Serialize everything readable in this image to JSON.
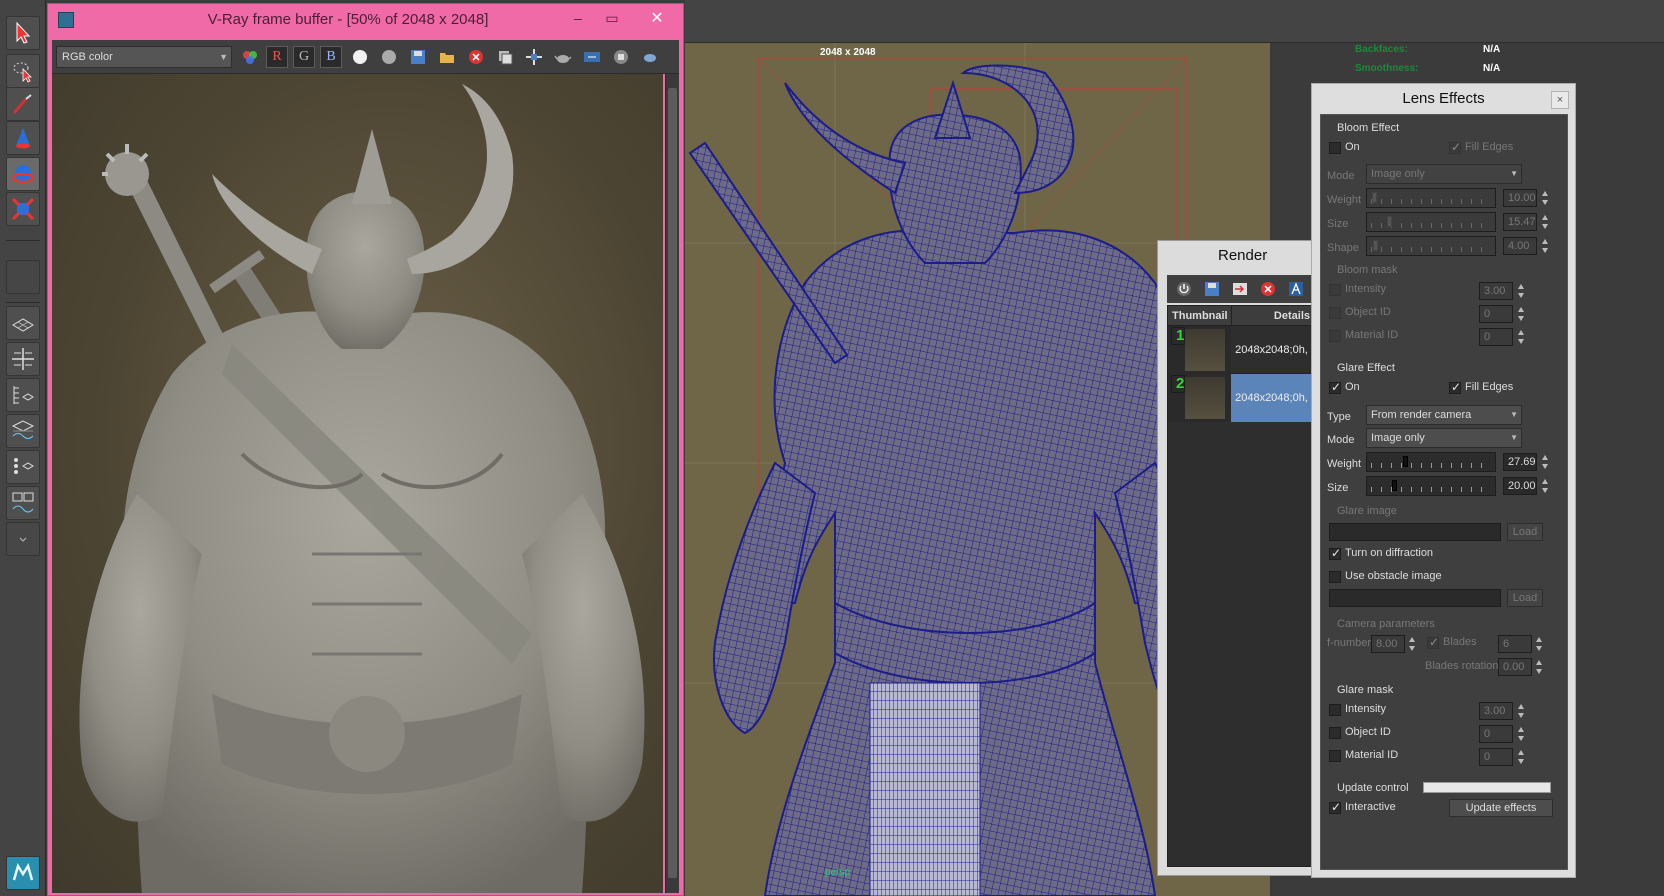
{
  "vfb": {
    "title": "V-Ray frame buffer - [50% of 2048 x 2048]",
    "channel": "RGB color",
    "channel_buttons": [
      "R",
      "G",
      "B"
    ]
  },
  "viewport": {
    "resolution_label": "2048 x 2048",
    "camera_label": "persp",
    "hud": [
      {
        "label": "Backfaces:",
        "value": "N/A"
      },
      {
        "label": "Smoothness:",
        "value": "N/A"
      }
    ],
    "hud_extra": [
      "efault",
      "057"
    ]
  },
  "render_history": {
    "title": "Render history",
    "columns": [
      "Thumbnail",
      "Details"
    ],
    "rows": [
      {
        "number": "1",
        "details": "2048x2048;0h,"
      },
      {
        "number": "2",
        "details": "2048x2048;0h,"
      }
    ]
  },
  "lens": {
    "title": "Lens Effects",
    "close": "×",
    "bloom": {
      "header": "Bloom Effect",
      "on_label": "On",
      "fill_edges_label": "Fill Edges",
      "mode_label": "Mode",
      "mode_value": "Image only",
      "weight_label": "Weight",
      "weight_value": "10.00",
      "size_label": "Size",
      "size_value": "15.47",
      "shape_label": "Shape",
      "shape_value": "4.00",
      "mask_header": "Bloom mask",
      "intensity_label": "Intensity",
      "intensity_value": "3.00",
      "object_id_label": "Object ID",
      "object_id_value": "0",
      "material_id_label": "Material ID",
      "material_id_value": "0"
    },
    "glare": {
      "header": "Glare Effect",
      "on_label": "On",
      "fill_edges_label": "Fill Edges",
      "type_label": "Type",
      "type_value": "From render camera",
      "mode_label": "Mode",
      "mode_value": "Image only",
      "weight_label": "Weight",
      "weight_value": "27.69",
      "size_label": "Size",
      "size_value": "20.00",
      "glare_image_label": "Glare image",
      "load_label": "Load",
      "diffraction_label": "Turn on diffraction",
      "obstacle_label": "Use obstacle image",
      "camera_params_header": "Camera parameters",
      "fnumber_label": "f-number",
      "fnumber_value": "8.00",
      "blades_label": "Blades",
      "blades_value": "6",
      "blades_rotation_label": "Blades rotation",
      "blades_rotation_value": "0.00",
      "mask_header": "Glare mask",
      "intensity_label": "Intensity",
      "intensity_value": "3.00",
      "object_id_label": "Object ID",
      "object_id_value": "0",
      "material_id_label": "Material ID",
      "material_id_value": "0"
    },
    "update": {
      "update_control_label": "Update control",
      "interactive_label": "Interactive",
      "update_button": "Update effects"
    }
  },
  "colors": {
    "vfb_frame": "#f06aa8",
    "wireframe": "#1c1c8a",
    "selected_row": "#5b84b8"
  }
}
